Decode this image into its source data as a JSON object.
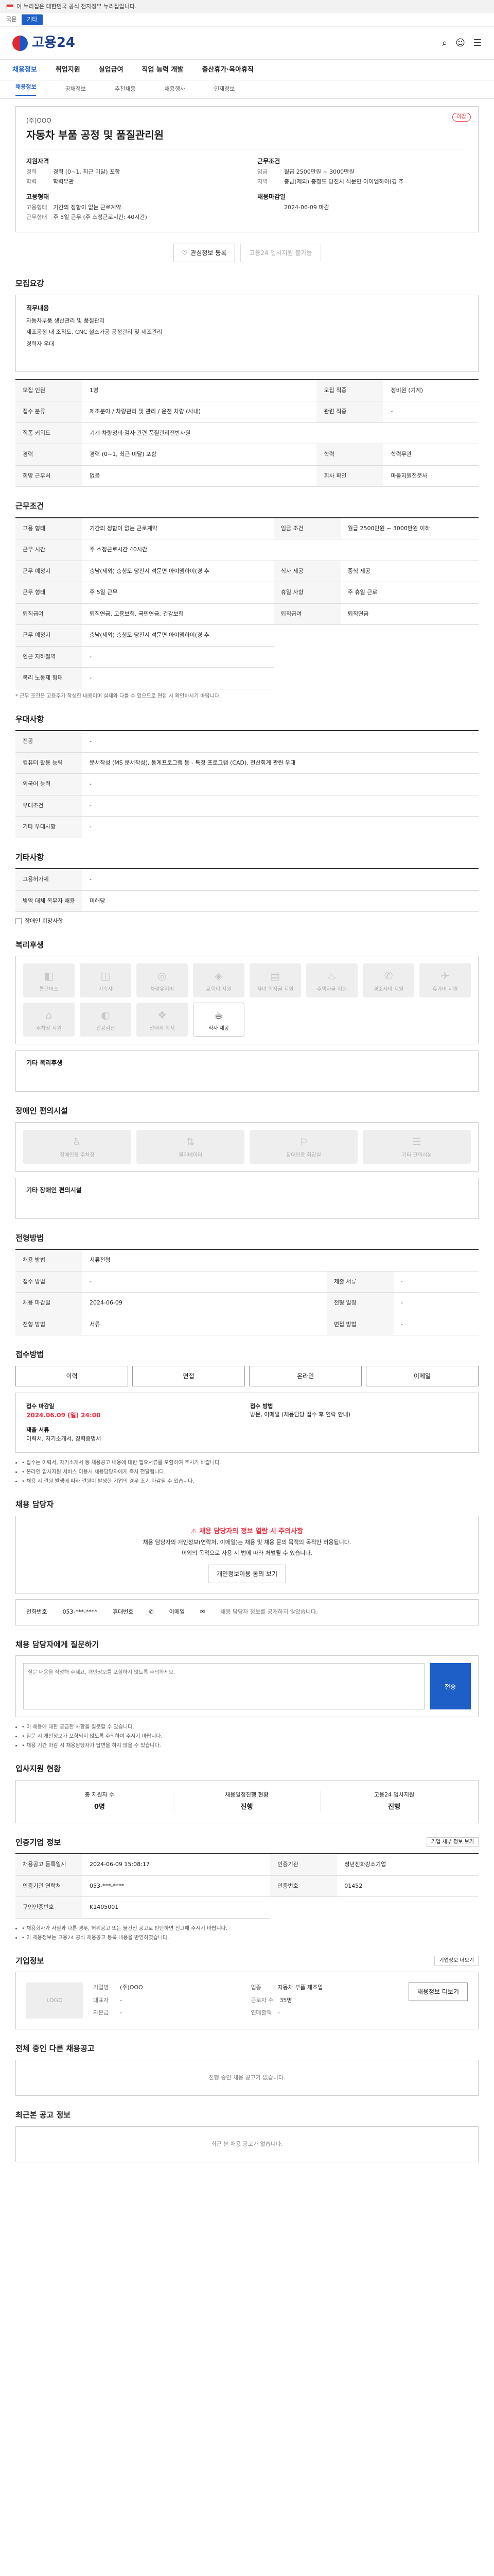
{
  "top": {
    "notice": "이 누리집은 대한민국 공식 전자정부 누리집입니다.",
    "lang": "국문",
    "tb_btn": "기타"
  },
  "header": {
    "logo": "고용24"
  },
  "gnb": [
    "채용정보",
    "취업지원",
    "실업급여",
    "직업 능력 개발",
    "출산휴가·육아휴직"
  ],
  "lnb": [
    "채용정보",
    "공채정보",
    "추천채용",
    "채용행사",
    "인재정보"
  ],
  "summary": {
    "badge": "마감",
    "company": "(주)OOO",
    "title": "자동차 부품 공정 및 품질관리원",
    "grid": [
      {
        "h": "지원자격",
        "rows": [
          [
            "경력",
            "경력 (0~1, 최근 미달) 포함"
          ],
          [
            "학력",
            "학력무관"
          ]
        ]
      },
      {
        "h": "근무조건",
        "rows": [
          [
            "임금",
            "월급 2500만원 ~ 3000만원"
          ],
          [
            "지역",
            "충남(제외) 충청도 당진시 석문면 아이엠하이(경 추"
          ]
        ]
      },
      {
        "h": "고용형태",
        "rows": [
          [
            "고용형태",
            "기간의 정함이 없는 근로계약"
          ],
          [
            "근무형태",
            "주 5일 근무 (주 소정근로시간: 40시간)"
          ]
        ]
      },
      {
        "h": "채용마감일",
        "rows": [
          [
            "",
            "2024-06-09 마감"
          ]
        ]
      }
    ],
    "btn_apply": "관심정보 등록",
    "btn_share": "고용24 입사지원 불가능"
  },
  "job_desc": {
    "title": "모집요강",
    "h": "직무내용",
    "lines": [
      "자동차부품 생산관리 및 품질관리",
      "제조공정 내 조직도, CNC 철스가공 공정관리 및 제조관리",
      "경력자 우대"
    ]
  },
  "job_table": [
    [
      "모집 인원",
      "1명",
      "모집 직종",
      "정비원 (기계)"
    ],
    [
      "접수 분류",
      "제조분야 / 차량관리 및 관리 / 운전 차량 (사내)",
      "관련 직종",
      "-"
    ],
    [
      "직종 키워드",
      "기계·차량정비·검사·관련 품질관리전반사원",
      "",
      ""
    ],
    [
      "경력",
      "경력 (0~1, 최근 미달) 포함",
      "학력",
      "학력무관"
    ],
    [
      "희망 근무처",
      "없음",
      "회사 확인",
      "마을지원전문사"
    ]
  ],
  "work_title": "근무조건",
  "work_table": [
    [
      "고용 형태",
      "기간의 정함이 없는 근로계약",
      "임금 조건",
      "월급 2500만원 ~ 3000만원 이하"
    ],
    [
      "근무 시간",
      "주 소정근로시간 40시간",
      "",
      ""
    ],
    [
      "근무 예정지",
      "충남(제외) 충청도 당진시 석문면 아이엠하이(경 추",
      "식사 제공",
      "중식 제공"
    ],
    [
      "근무 형태",
      "주 5일 근무",
      "휴일 사항",
      "주 휴일 근로"
    ],
    [
      "퇴직급여",
      "퇴직연금, 고용보험, 국민연금, 건강보험",
      "퇴직급여",
      "퇴직연금"
    ],
    [
      "근무 예정지",
      "충남(제외) 충청도 당진시 석문면 아이엠하이(경 추",
      "",
      ""
    ],
    [
      "인근 지하철역",
      "-",
      "",
      ""
    ],
    [
      "복리 노동제 형태",
      "-",
      "",
      ""
    ]
  ],
  "work_note": "* 근무 조건은 고용주가 작성한 내용이며 실제와 다를 수 있으므로 면접 시 확인하시기 바랍니다.",
  "pref_title": "우대사항",
  "pref_table": [
    [
      "전공",
      "-"
    ],
    [
      "컴퓨터 활용 능력",
      "문서작성 (MS 문서작성), 통계프로그램 등 - 특정 프로그램 (CAD), 전산회계 관련 우대"
    ],
    [
      "외국어 능력",
      "-"
    ],
    [
      "우대조건",
      "-"
    ],
    [
      "기타 우대사항",
      "-"
    ]
  ],
  "emp_title": "기타사항",
  "emp_table": [
    [
      "고용허가제",
      "-"
    ],
    [
      "병역 대체 복무자 채용",
      "미해당"
    ]
  ],
  "emp_check": "장애인 희망사항",
  "welfare_title": "복리후생",
  "welfare": [
    [
      "◧",
      "통근버스",
      false
    ],
    [
      "◫",
      "기숙사",
      false
    ],
    [
      "◎",
      "차량유지비",
      false
    ],
    [
      "◈",
      "교육비 지원",
      false
    ],
    [
      "▤",
      "자녀 학자금 지원",
      false
    ],
    [
      "♨",
      "주택자금 지원",
      false
    ],
    [
      "✆",
      "경조사비 지원",
      false
    ],
    [
      "✈",
      "휴가비 지원",
      false
    ],
    [
      "⌂",
      "주차장 지원",
      false
    ],
    [
      "◐",
      "건강검진",
      false
    ],
    [
      "❖",
      "선택적 복지",
      false
    ],
    [
      "☕",
      "식사 제공",
      true
    ]
  ],
  "welfare_sub": "기타 복리후생",
  "disab_title": "장애인 편의시설",
  "disab": [
    [
      "♿",
      "장애인용 주차장"
    ],
    [
      "⇅",
      "엘리베이터"
    ],
    [
      "⚐",
      "장애인용 화장실"
    ],
    [
      "☰",
      "기타 편의시설"
    ]
  ],
  "disab_sub": "기타 장애인 편의시설",
  "sel_title": "전형방법",
  "sel_table": [
    [
      "채용 방법",
      "서류전형",
      "",
      ""
    ],
    [
      "접수 방법",
      "-",
      "제출 서류",
      "-"
    ],
    [
      "채용 마감일",
      "2024-06-09",
      "전형 일정",
      "-"
    ],
    [
      "전형 방법",
      "서류",
      "면접 방법",
      "-"
    ]
  ],
  "apply_title": "접수방법",
  "apply_btns": [
    "이력",
    "면접",
    "온라인",
    "이메일"
  ],
  "apply_info": {
    "k1": "접수 마감일",
    "v1": "2024.06.09 (일) 24:00",
    "k2": "접수 방법",
    "v2": "방문, 이메일 (채용담당 접수 후 연락 안내)",
    "k3": "제출 서류",
    "v3": "이력서, 자기소개서, 경력증명서"
  },
  "apply_notes": [
    "• 접수는 이력서, 자기소개서 등 채용공고 내용에 대한 필요서류를 포함하여 주시기 바랍니다.",
    "• 온라인 입사지원 서비스 이용시 채용담당자에게 즉시 전달됩니다.",
    "• 채용 시 결원 발생에 따라 결원이 발생한 기업의 경우 조기 마감될 수 있습니다."
  ],
  "contact_title": "채용 담당자",
  "contact_alert": "채용 담당자의 정보 열람 시 주의사항",
  "contact_lines": [
    "채용 담당자의 개인정보(연락처, 이메일)는 채용 및 채용 문의 목적의 목적만 허용됩니다.",
    "이외의 목적으로 사용 시 법에 따라 처벌될 수 있습니다."
  ],
  "contact_btn": "개인정보이용 동의 보기",
  "mgr": {
    "k1": "전화번호",
    "v1": "053-***-****",
    "k2": "휴대번호",
    "k3": "이메일",
    "note": "채용 담당자 정보를 공개하지 않았습니다."
  },
  "qna_title": "채용 담당자에게 질문하기",
  "qna_placeholder": "질문 내용을 작성해 주세요. 개인정보를 포함하지 않도록 주의하세요.",
  "qna_send": "전송",
  "qna_notes": [
    "• 이 채용에 대한 궁금한 사항을 질문할 수 있습니다.",
    "• 질문 시 개인정보가 포함되지 않도록 주의하여 주시기 바랍니다.",
    "• 채용 기간 마감 시 채용담당자가 답변을 하지 않을 수 있습니다."
  ],
  "status_title": "입사지원 현황",
  "status": [
    [
      "총 지원자 수",
      "0명"
    ],
    [
      "채용일정진행 현황",
      "진행"
    ],
    [
      "고용24 입사지원",
      "진행"
    ]
  ],
  "reg_title": "인증기업 정보",
  "reg_btn": "기업 세부 정보 보기",
  "reg_table": [
    [
      "채용공고 등록일시",
      "2024-06-09 15:08:17",
      "인증기관",
      "청년친화강소기업"
    ],
    [
      "인증기관 연락처",
      "053-***-****",
      "인증번호",
      "01452"
    ],
    [
      "구인인증번호",
      "K1405001",
      "",
      ""
    ]
  ],
  "reg_notes": [
    "• 채용회사가 사실과 다른 경우, 허위공고 또는 불건전 공고로 판단하면 신고해 주시기 바랍니다.",
    "• 이 채용정보는 고용24 공식 채용공고 등록 내용을 반영하였습니다."
  ],
  "corp_title": "기업정보",
  "corp_more": "기업정보 더보기",
  "corp_logo": "LOGO",
  "corp_btn": "채용정보 더보기",
  "corp_rows": [
    [
      "기업명",
      "(주)OOO"
    ],
    [
      "업종",
      "자동차 부품 제조업"
    ],
    [
      "대표자",
      "-"
    ],
    [
      "근로자 수",
      "35명"
    ],
    [
      "자본금",
      "-"
    ],
    [
      "연매출액",
      "-"
    ]
  ],
  "other_title": "전체 중인 다른 채용공고",
  "other_empty": "진행 중인 채용 공고가 없습니다.",
  "recent_title": "최근본 공고 정보",
  "recent_empty": "최근 본 채용 공고가 없습니다."
}
